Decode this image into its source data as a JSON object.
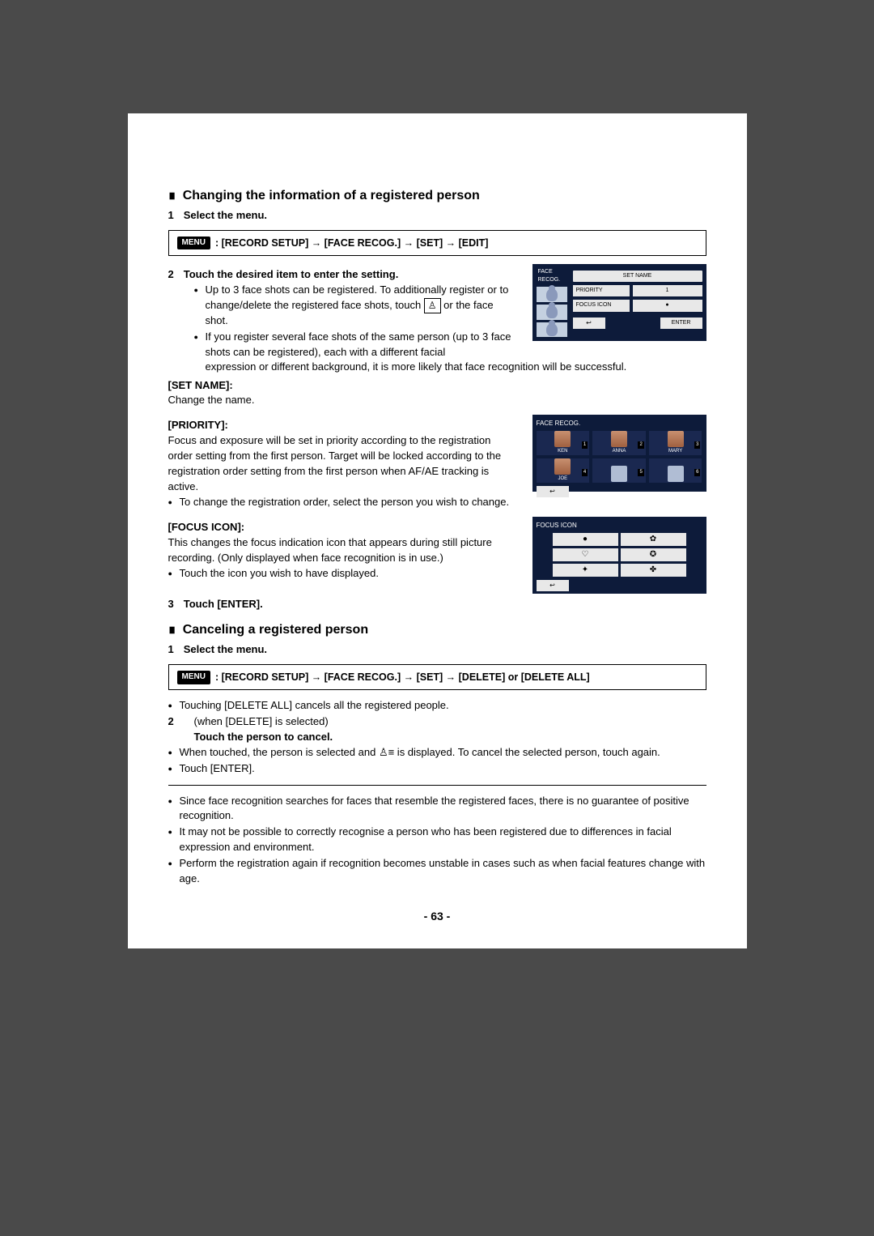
{
  "section1": {
    "title": "Changing the information of a registered person",
    "step1": {
      "num": "1",
      "label": "Select the menu."
    },
    "menu1": {
      "pill": "MENU",
      "path": ": [RECORD SETUP] → [FACE RECOG.] → [SET] → [EDIT]"
    },
    "step2": {
      "num": "2",
      "label": "Touch the desired item to enter the setting."
    },
    "bullets2a": "Up to 3 face shots can be registered. To additionally register or to change/delete the registered face shots, touch ",
    "bullets2a_after": " or the face shot.",
    "bullets2b": "If you register several face shots of the same person (up to 3 face shots can be registered), each with a different facial expression or different background, it is more likely that face recognition will be successful.",
    "setname": {
      "label": "[SET NAME]:",
      "text": "Change the name."
    },
    "priority": {
      "label": "[PRIORITY]:",
      "text": "Focus and exposure will be set in priority according to the registration order setting from the first person. Target will be locked according to the registration order setting from the first person when AF/AE tracking is active.",
      "bullet": "To change the registration order, select the person you wish to change."
    },
    "focusicon": {
      "label": "[FOCUS ICON]:",
      "text": "This changes the focus indication icon that appears during still picture recording. (Only displayed when face recognition is in use.)",
      "bullet": "Touch the icon you wish to have displayed."
    },
    "step3": {
      "num": "3",
      "label": "Touch [ENTER]."
    }
  },
  "section2": {
    "title": "Canceling a registered person",
    "step1": {
      "num": "1",
      "label": "Select the menu."
    },
    "menu2": {
      "pill": "MENU",
      "path": ": [RECORD SETUP] → [FACE RECOG.] → [SET] → [DELETE] or [DELETE ALL]"
    },
    "bullet1": "Touching [DELETE ALL] cancels all the registered people.",
    "step2": {
      "num": "2",
      "label_pre": "(when [DELETE] is selected)",
      "label": "Touch the person to cancel."
    },
    "bullet2a_pre": "When touched, the person is selected and ",
    "bullet2a_post": " is displayed. To cancel the selected person, touch again.",
    "bullet2b": "Touch [ENTER].",
    "notes": [
      "Since face recognition searches for faces that resemble the registered faces, there is no guarantee of positive recognition.",
      "It may not be possible to correctly recognise a person who has been registered due to differences in facial expression and environment.",
      "Perform the registration again if recognition becomes unstable in cases such as when facial features change with age."
    ]
  },
  "ui1": {
    "title": "FACE RECOG.",
    "setname_btn": "SET NAME",
    "priority_btn": "PRIORITY",
    "priority_val": "1",
    "focusicon_btn": "FOCUS ICON",
    "focusicon_val": "●",
    "enter": "ENTER"
  },
  "ui2": {
    "title": "FACE RECOG.",
    "names": [
      "KEN",
      "ANNA",
      "MARY",
      "JOE",
      "",
      ""
    ]
  },
  "ui3": {
    "title": "FOCUS ICON",
    "icons": [
      "●",
      "✿",
      "♡",
      "✪",
      "✦",
      "✤"
    ]
  },
  "pageNum": "- 63 -"
}
